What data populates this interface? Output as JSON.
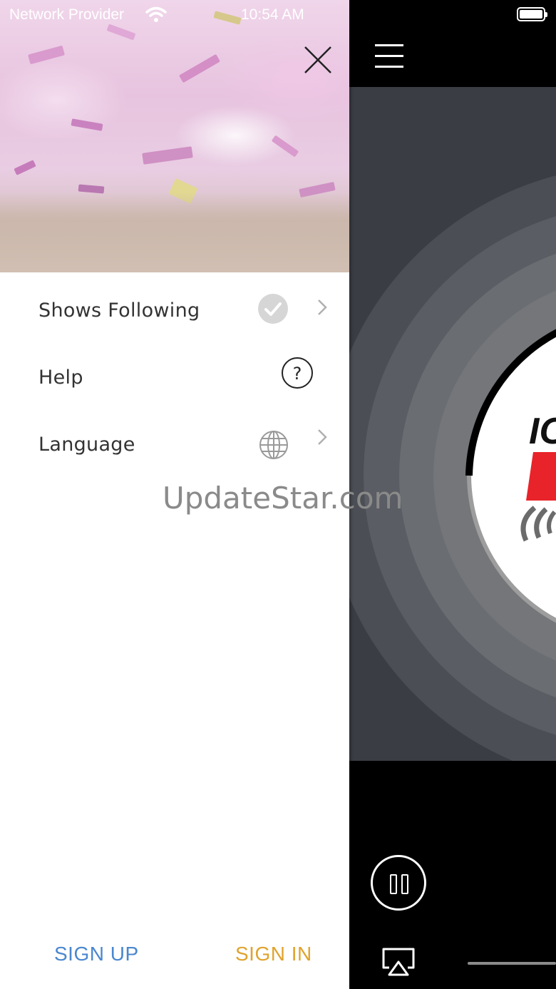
{
  "status_bar": {
    "carrier": "Network Provider",
    "time": "10:54 AM"
  },
  "drawer": {
    "menu": [
      {
        "label": "Shows Following",
        "icon": "check-circle-icon",
        "has_chevron": true
      },
      {
        "label": "Help",
        "icon": "question-circle-icon",
        "has_chevron": false
      },
      {
        "label": "Language",
        "icon": "globe-icon",
        "has_chevron": true
      }
    ],
    "footer": {
      "signup_label": "SIGN UP",
      "signin_label": "SIGN IN"
    }
  },
  "watermark": "UpdateStar.com",
  "colors": {
    "signup": "#4a87cf",
    "signin": "#e0a32e",
    "logo_red": "#e8242a"
  },
  "player": {
    "state": "playing",
    "controls": [
      "pause-icon",
      "airplay-icon"
    ]
  }
}
